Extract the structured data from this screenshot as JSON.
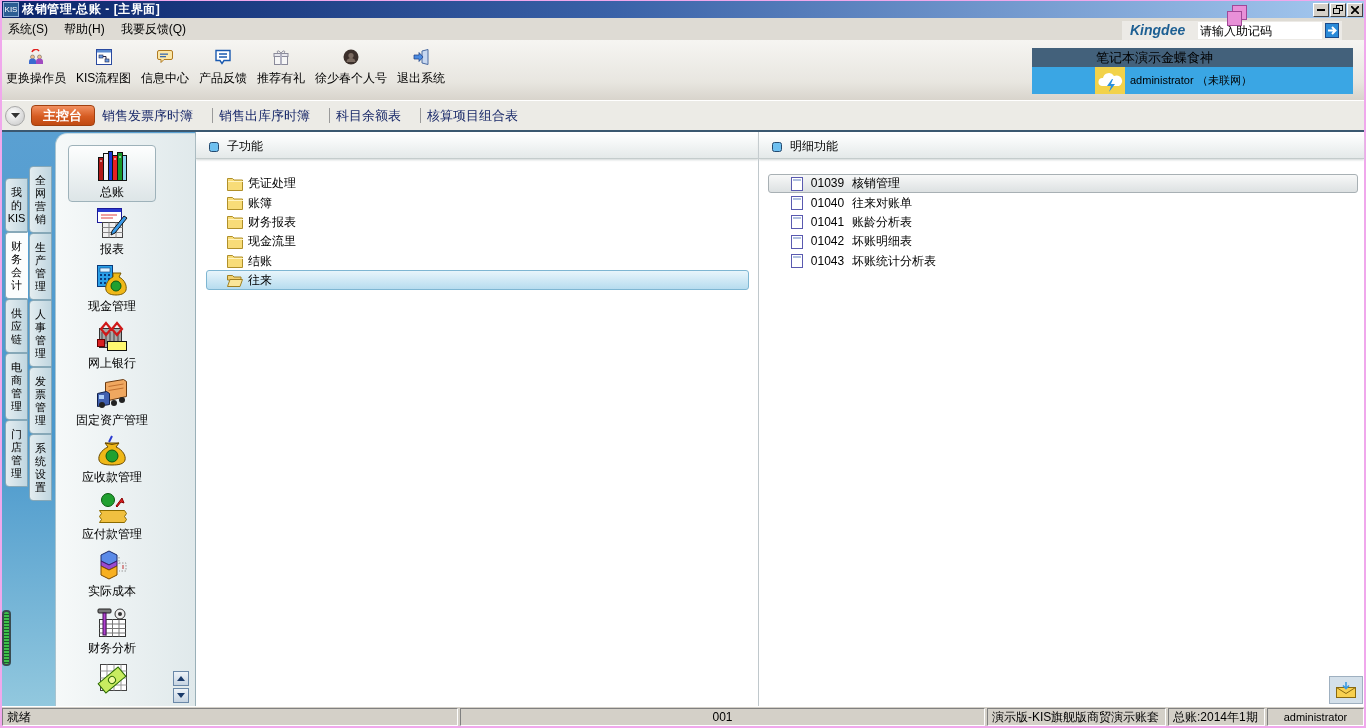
{
  "window": {
    "app_badge": "KIS",
    "title": "核销管理-总账 - [主界面]"
  },
  "menu": [
    "系统(S)",
    "帮助(H)",
    "我要反馈(Q)"
  ],
  "quick_search": {
    "brand": "Kingdee",
    "placeholder": "请输入助记码"
  },
  "toolbar": [
    "更换操作员",
    "KIS流程图",
    "信息中心",
    "产品反馈",
    "推荐有礼",
    "徐少春个人号",
    "退出系统"
  ],
  "account": {
    "company": "笔记本演示金蝶食神",
    "user": "administrator （未联网）"
  },
  "tabs": [
    {
      "label": "主控台",
      "selected": true
    },
    {
      "label": "销售发票序时簿",
      "selected": false
    },
    {
      "label": "销售出库序时簿",
      "selected": false
    },
    {
      "label": "科目余额表",
      "selected": false
    },
    {
      "label": "核算项目组合表",
      "selected": false
    }
  ],
  "category_tabs": {
    "left_column": [
      {
        "label": "我的KIS",
        "selected": false
      },
      {
        "label": "财务会计",
        "selected": true
      },
      {
        "label": "供应链",
        "selected": false
      },
      {
        "label": "电商管理",
        "selected": false
      },
      {
        "label": "门店管理",
        "selected": false
      }
    ],
    "right_column": [
      {
        "label": "全网营销",
        "selected": false
      },
      {
        "label": "生产管理",
        "selected": false
      },
      {
        "label": "人事管理",
        "selected": false
      },
      {
        "label": "发票管理",
        "selected": false
      },
      {
        "label": "系统设置",
        "selected": false
      }
    ]
  },
  "modules": [
    {
      "label": "总账",
      "selected": true
    },
    {
      "label": "报表",
      "selected": false
    },
    {
      "label": "现金管理",
      "selected": false
    },
    {
      "label": "网上银行",
      "selected": false
    },
    {
      "label": "固定资产管理",
      "selected": false
    },
    {
      "label": "应收款管理",
      "selected": false
    },
    {
      "label": "应付款管理",
      "selected": false
    },
    {
      "label": "实际成本",
      "selected": false
    },
    {
      "label": "财务分析",
      "selected": false
    },
    {
      "selected": false
    }
  ],
  "sub_functions": {
    "title": "子功能",
    "items": [
      {
        "label": "凭证处理",
        "selected": false
      },
      {
        "label": "账簿",
        "selected": false
      },
      {
        "label": "财务报表",
        "selected": false
      },
      {
        "label": "现金流里",
        "selected": false
      },
      {
        "label": "结账",
        "selected": false
      },
      {
        "label": "往来",
        "selected": true
      }
    ]
  },
  "detail_functions": {
    "title": "明细功能",
    "items": [
      {
        "code": "01039",
        "name": "核销管理",
        "selected": true
      },
      {
        "code": "01040",
        "name": "往来对账单",
        "selected": false
      },
      {
        "code": "01041",
        "name": "账龄分析表",
        "selected": false
      },
      {
        "code": "01042",
        "name": "坏账明细表",
        "selected": false
      },
      {
        "code": "01043",
        "name": "坏账统计分析表",
        "selected": false
      }
    ]
  },
  "status_bar": [
    "就绪",
    "001",
    "演示版-KIS旗舰版商贸演示账套",
    "总账:2014年1期",
    "administrator"
  ]
}
